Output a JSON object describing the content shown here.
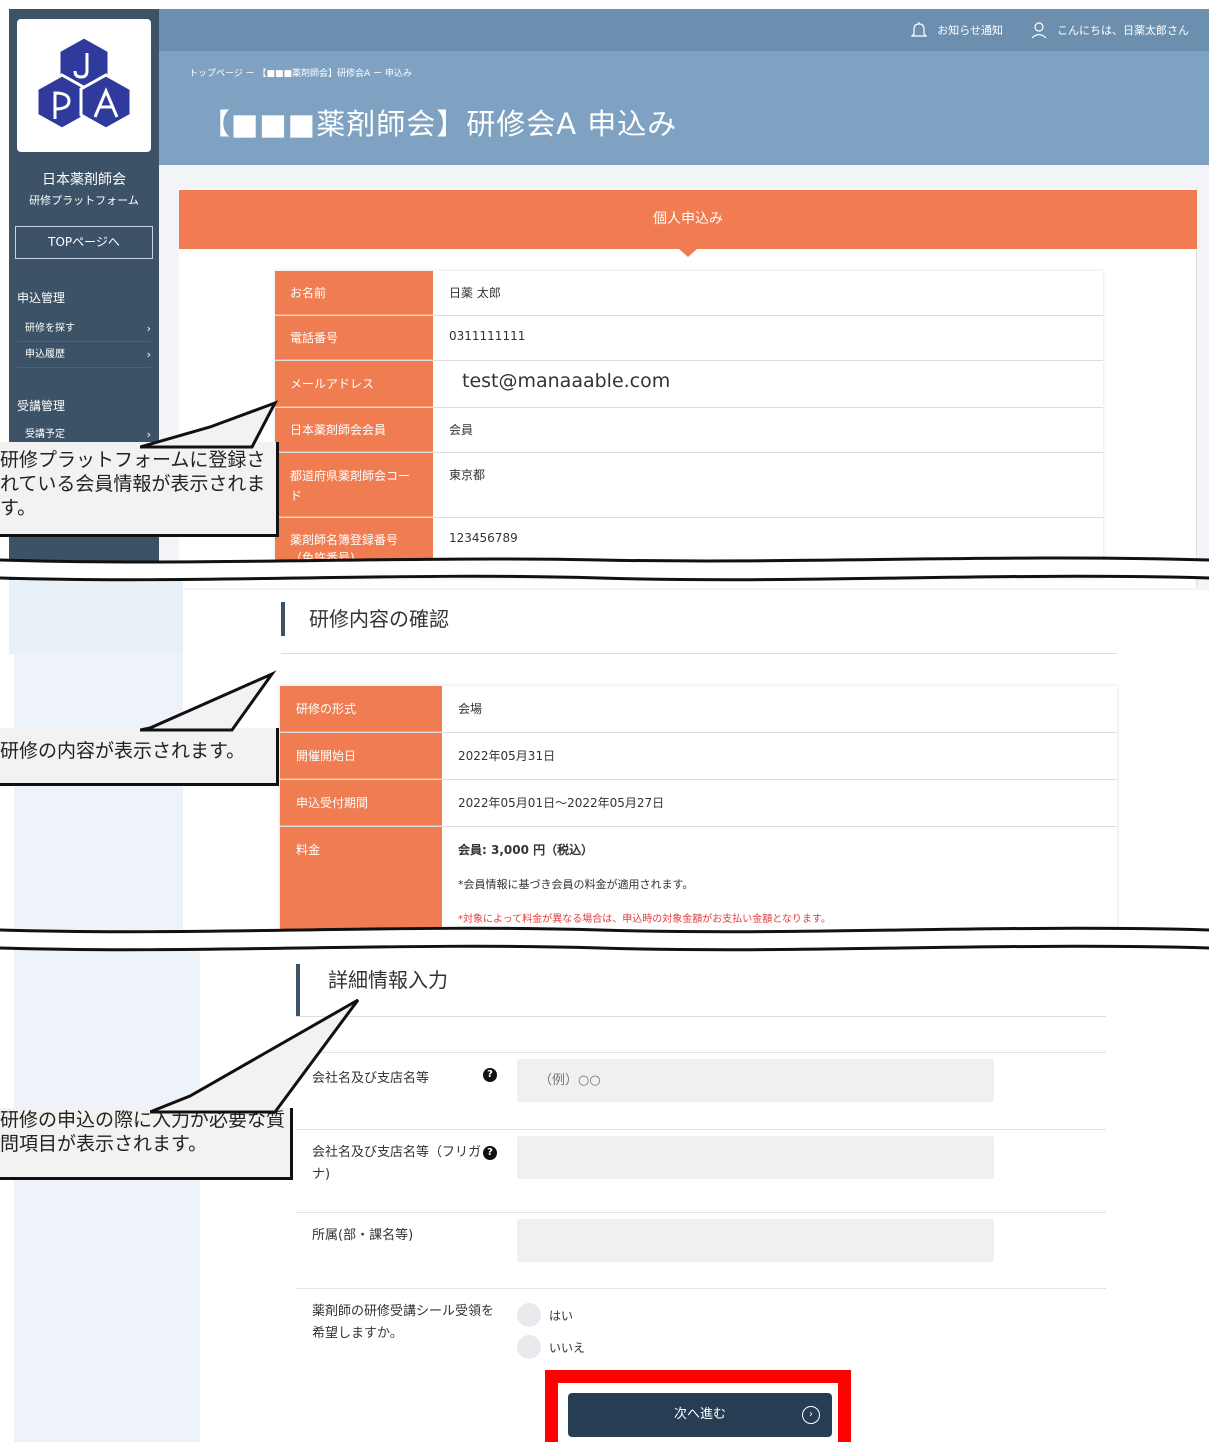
{
  "sidebar": {
    "brand_name": "日本薬剤師会",
    "brand_sub": "研修プラットフォーム",
    "top_button": "TOPページへ",
    "section_apply": "申込管理",
    "items_apply": [
      {
        "label": "研修を探す"
      },
      {
        "label": "申込履歴"
      }
    ],
    "section_course": "受講管理",
    "items_course": [
      {
        "label": "受講予定"
      }
    ],
    "logo_letters": "J P A"
  },
  "header": {
    "notification": "お知らせ通知",
    "greeting": "こんにちは、日薬太郎さん",
    "breadcrumb": "トップページ ー 【■■■薬剤師会】研修会A ー 申込み",
    "page_title": "【■■■薬剤師会】研修会A 申込み"
  },
  "personal": {
    "panel_title": "個人申込み",
    "rows": [
      {
        "label": "お名前",
        "value": "日薬 太郎"
      },
      {
        "label": "電話番号",
        "value": "0311111111"
      },
      {
        "label": "メールアドレス",
        "value": "test@manaaable.com"
      },
      {
        "label": "日本薬剤師会会員",
        "value": "会員"
      },
      {
        "label": "都道府県薬剤師会コード",
        "value": "東京都"
      },
      {
        "label": "薬剤師名簿登録番号（免許番号)",
        "value": "123456789"
      }
    ]
  },
  "course": {
    "section_title": "研修内容の確認",
    "rows": [
      {
        "label": "研修の形式",
        "value": "会場"
      },
      {
        "label": "開催開始日",
        "value": "2022年05月31日"
      },
      {
        "label": "申込受付期間",
        "value": "2022年05月01日〜2022年05月27日"
      }
    ],
    "fee_label": "料金",
    "fee_main": "会員: 3,000 円（税込）",
    "fee_note": "*会員情報に基づき会員の料金が適用されます。",
    "fee_warning": "*対象によって料金が異なる場合は、申込時の対象金額がお支払い金額となります。"
  },
  "details": {
    "section_title": "詳細情報入力",
    "company_label": "会社名及び支店名等",
    "company_placeholder": "（例）○○",
    "company_kana_label": "会社名及び支店名等（フリガナ)",
    "affiliation_label": "所属(部・課名等)",
    "seal_label": "薬剤師の研修受講シール受領を希望しますか。",
    "option_yes": "はい",
    "option_no": "いいえ",
    "next_button": "次へ進む"
  },
  "callouts": {
    "member_info": "研修プラットフォームに登録されている会員情報が表示されます。",
    "course_info": "研修の内容が表示されます。",
    "questions": "研修の申込の際に入力が必要な質問項目が表示されます。"
  },
  "colors": {
    "sidebar": "#3c5266",
    "header": "#7fa2c2",
    "accent_orange": "#f07c52",
    "button_dark": "#263e53",
    "highlight_red": "#ff0000"
  }
}
